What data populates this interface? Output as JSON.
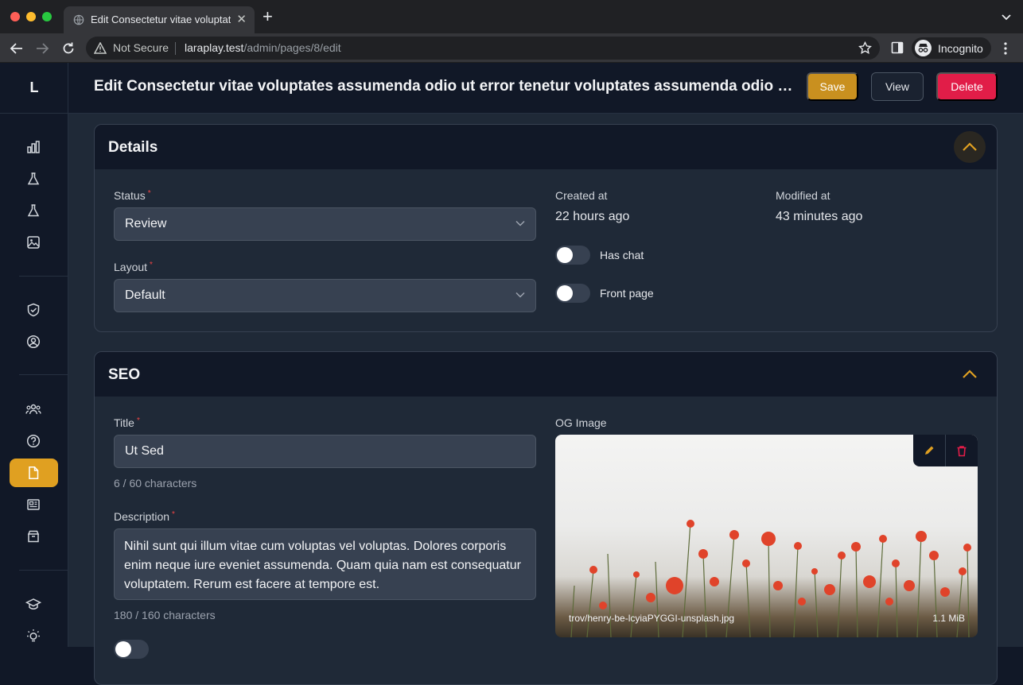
{
  "browser": {
    "tab_title": "Edit Consectetur vitae voluptat",
    "security_label": "Not Secure",
    "url_host": "laraplay.test",
    "url_path": "/admin/pages/8/edit",
    "incognito_label": "Incognito"
  },
  "app": {
    "logo": "L"
  },
  "header": {
    "title": "Edit Consectetur vitae voluptates assumenda odio ut error tenetur voluptates assumenda odio ut error tenetur",
    "save_label": "Save",
    "view_label": "View",
    "delete_label": "Delete"
  },
  "details": {
    "title": "Details",
    "status_label": "Status",
    "status_value": "Review",
    "layout_label": "Layout",
    "layout_value": "Default",
    "created_label": "Created at",
    "created_value": "22 hours ago",
    "modified_label": "Modified at",
    "modified_value": "43 minutes ago",
    "has_chat_label": "Has chat",
    "front_page_label": "Front page"
  },
  "seo": {
    "title": "SEO",
    "title_label": "Title",
    "title_value": "Ut Sed",
    "title_count": "6 / 60 characters",
    "description_label": "Description",
    "description_value": "Nihil sunt qui illum vitae cum voluptas vel voluptas. Dolores corporis enim neque iure eveniet assumenda. Quam quia nam est consequatur voluptatem. Rerum est facere at tempore est.",
    "description_count": "180 / 160 characters",
    "og_label": "OG Image",
    "og_filename": "trov/henry-be-lcyiaPYGGI-unsplash.jpg",
    "og_size": "1.1 MiB"
  },
  "colors": {
    "accent": "#e0a021",
    "danger": "#e11d48",
    "required": "#ef4444"
  }
}
